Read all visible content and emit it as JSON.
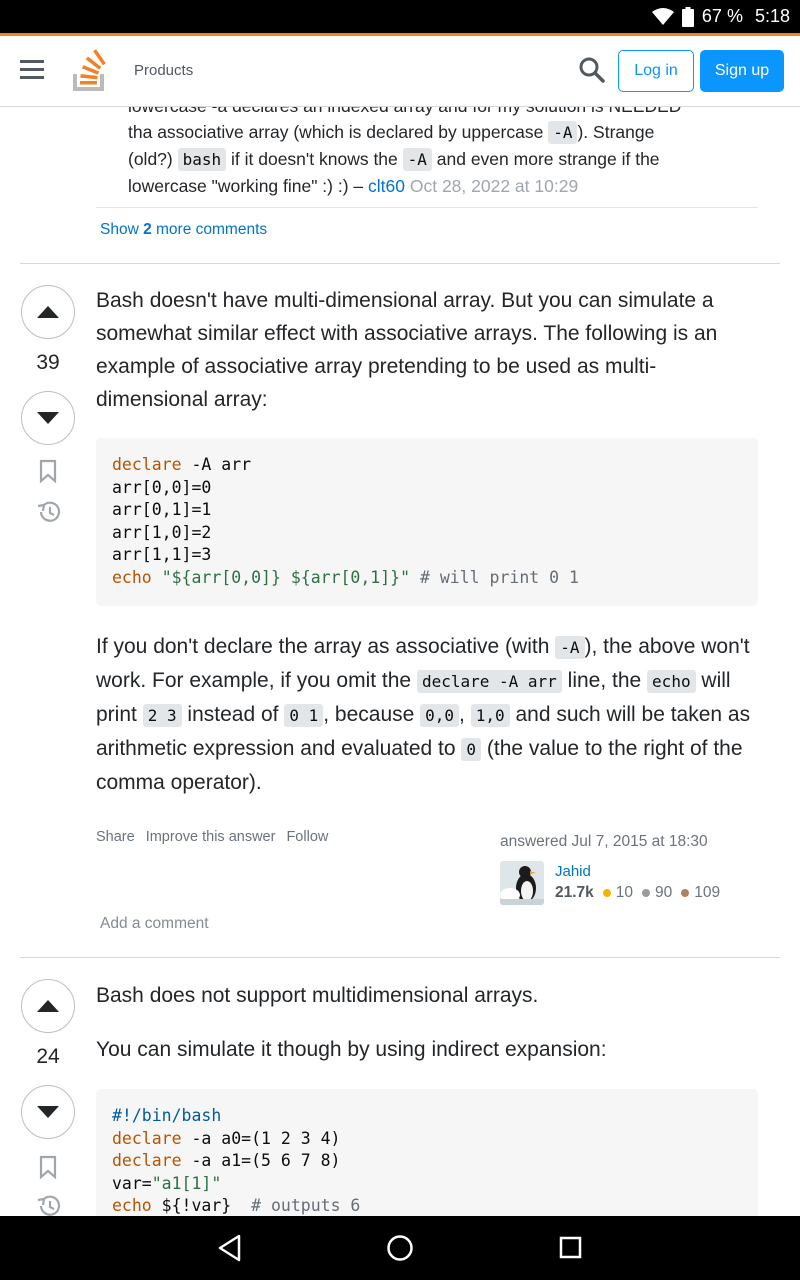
{
  "status_bar": {
    "battery": "67 %",
    "time": "5:18"
  },
  "header": {
    "products": "Products",
    "login": "Log in",
    "signup": "Sign up",
    "brand_color": "#f48225",
    "accent_color": "#0a95ff"
  },
  "comment": {
    "line1": "lowercase -a declares an indexed array and for my solution is NEEDED",
    "l2_a": "tha associative array (which is declared by uppercase ",
    "l2_code": "-A",
    "l2_b": "). Strange",
    "l3_a": "(old?) ",
    "l3_code": "bash",
    "l3_b": " if it doesn't knows the ",
    "l3_code2": "-A",
    "l3_c": " and even more strange if the",
    "l4_a": "lowercase \"working fine\" :) :) – ",
    "user": "clt60",
    "date": "Oct 28, 2022 at 10:29",
    "show_more_a": "Show ",
    "show_more_num": "2",
    "show_more_b": " more comments"
  },
  "answer1": {
    "votes": "39",
    "intro": "Bash doesn't have multi-dimensional array. But you can simulate a somewhat similar effect with associative arrays. The following is an example of associative array pretending to be used as multi-dimensional array:",
    "code": {
      "l1_kw": "declare",
      "l1_rest": " -A arr",
      "l2": "arr[0,0]=0",
      "l3": "arr[0,1]=1",
      "l4": "arr[1,0]=2",
      "l5": "arr[1,1]=3",
      "l6_kw": "echo",
      "l6_str": "\"${arr[0,0]} ${arr[0,1]}\"",
      "l6_cm": "# will print 0 1"
    },
    "p2": {
      "t1": "If you don't declare the array as associative (with ",
      "c1": "-A",
      "t2": "), the above won't work. For example, if you omit the ",
      "c2": "declare -A arr",
      "t3": " line, the ",
      "c3": "echo",
      "t4": " will print ",
      "c4": "2 3",
      "t5": " instead of ",
      "c5": "0 1",
      "t6": ", because ",
      "c6": "0,0",
      "t7": ", ",
      "c7": "1,0",
      "t8": " and such will be taken as arithmetic expression and evaluated to ",
      "c8": "0",
      "t9": " (the value to the right of the comma operator)."
    },
    "menu": {
      "share": "Share",
      "improve": "Improve this answer",
      "follow": "Follow"
    },
    "signature": {
      "time": "answered Jul 7, 2015 at 18:30",
      "user": "Jahid",
      "rep": "21.7k",
      "gold": "10",
      "silver": "90",
      "bronze": "109"
    },
    "add_comment": "Add a comment"
  },
  "answer2": {
    "votes": "24",
    "p1": "Bash does not support multidimensional arrays.",
    "p2": "You can simulate it though by using indirect expansion:",
    "code": {
      "l1": "#!/bin/bash",
      "l2_kw": "declare",
      "l2_rest": " -a a0=(1 2 3 4)",
      "l3_kw": "declare",
      "l3_rest": " -a a1=(5 6 7 8)",
      "l4_a": "var=",
      "l4_str": "\"a1[1]\"",
      "l5_kw": "echo",
      "l5_rest": " ${!var}  ",
      "l5_cm": "# outputs 6"
    }
  }
}
